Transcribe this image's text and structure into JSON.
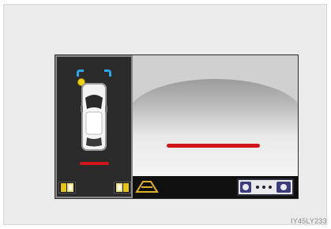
{
  "figure": {
    "code": "IY45LY233"
  },
  "display": {
    "left_panel": {
      "vehicle": "vehicle-top-view-icon",
      "guide_color": "#d0161a",
      "corner_bracket_color": "#2aa6e6",
      "sensor_dot_color": "#f2d21a"
    },
    "right_panel": {
      "view": "rear-camera-view",
      "guide_color": "#d0161a"
    },
    "icons": {
      "left_camera": "camera-indicator-icon",
      "right_camera": "camera-indicator-icon",
      "view_switch": "view-switch-icon",
      "parking_assist": "parking-assist-icon"
    }
  }
}
